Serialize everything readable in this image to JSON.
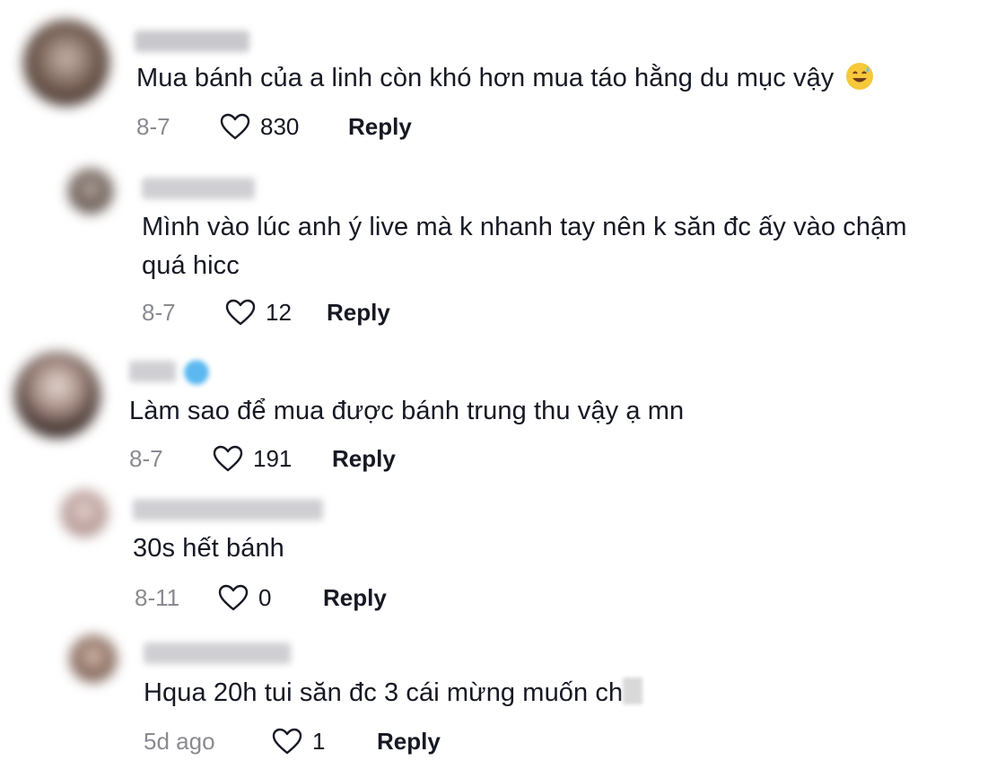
{
  "reply_label": "Reply",
  "comments": [
    {
      "username": "Nhật Linh",
      "text": "Mua bánh của a linh còn khó hơn mua táo hằng du mục vậy",
      "emoji": "sweat-smile-emoji",
      "date": "8-7",
      "likes": "830",
      "is_reply": false
    },
    {
      "username": "Nhật Linh",
      "text_line1": "Mình vào lúc anh ý live mà k nhanh tay nên k săn đc ấy vào chậm",
      "text_line2": "quá hicc",
      "date": "8-7",
      "likes": "12",
      "is_reply": true
    },
    {
      "username": "Bơn",
      "verified": true,
      "text": "Làm sao để mua được bánh trung thu vậy ạ mn",
      "date": "8-7",
      "likes": "191",
      "is_reply": false
    },
    {
      "username": "Phương Nguyễn",
      "text": "30s hết bánh",
      "date": "8-11",
      "likes": "0",
      "is_reply": true
    },
    {
      "username": "Thanh Hạnh",
      "text": "Hqua 20h tui săn đc 3 cái mừng muốn ch",
      "date": "5d ago",
      "likes": "1",
      "is_reply": true
    }
  ],
  "colors": {
    "text": "#161823",
    "meta": "#8a8b91",
    "background": "#ffffff"
  }
}
